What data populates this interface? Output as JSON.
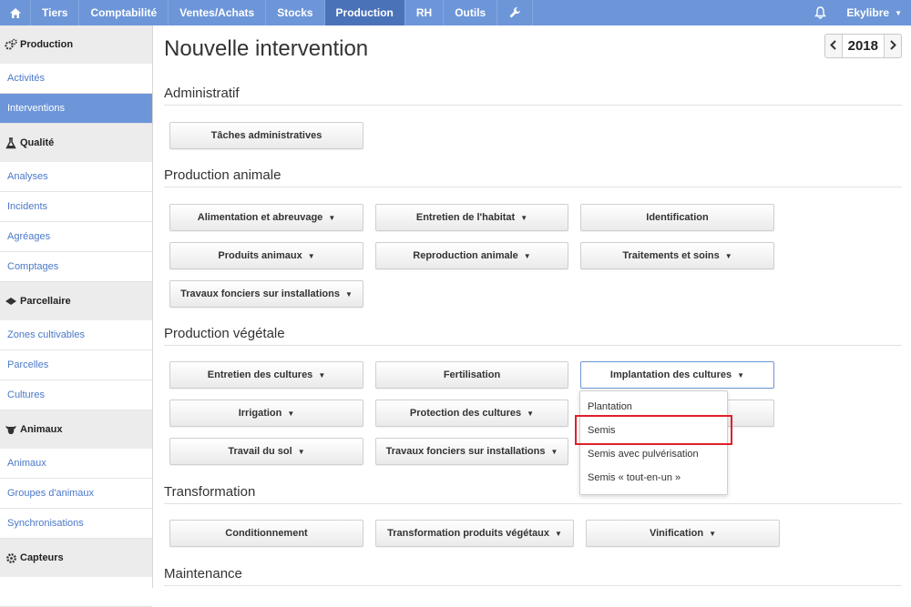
{
  "topbar": {
    "home_icon": "home-icon",
    "items": [
      "Tiers",
      "Comptabilité",
      "Ventes/Achats",
      "Stocks",
      "Production",
      "RH",
      "Outils"
    ],
    "active_index": 4,
    "tools_icon": "wrench-icon",
    "bell_icon": "bell-icon",
    "user": "Ekylibre"
  },
  "sidebar": {
    "sections": [
      {
        "title": "Production",
        "icon": "gears-icon",
        "items": [
          "Activités",
          "Interventions"
        ],
        "active": 1
      },
      {
        "title": "Qualité",
        "icon": "flask-icon",
        "items": [
          "Analyses",
          "Incidents",
          "Agréages",
          "Comptages"
        ]
      },
      {
        "title": "Parcellaire",
        "icon": "map-icon",
        "items": [
          "Zones cultivables",
          "Parcelles",
          "Cultures"
        ]
      },
      {
        "title": "Animaux",
        "icon": "cow-icon",
        "items": [
          "Animaux",
          "Groupes d'animaux",
          "Synchronisations"
        ]
      },
      {
        "title": "Capteurs",
        "icon": "gear-icon",
        "items": []
      }
    ]
  },
  "page": {
    "title": "Nouvelle intervention",
    "year": "2018",
    "prev_icon": "chevron-left-icon",
    "next_icon": "chevron-right-icon"
  },
  "sections": {
    "admin": {
      "title": "Administratif",
      "buttons": [
        "Tâches administratives"
      ]
    },
    "animal": {
      "title": "Production animale",
      "buttons": [
        "Alimentation et abreuvage",
        "Entretien de l'habitat",
        "Identification",
        "Produits animaux",
        "Reproduction animale",
        "Traitements et soins",
        "Travaux fonciers sur installations"
      ]
    },
    "vegetal": {
      "title": "Production végétale",
      "buttons": [
        "Entretien des cultures",
        "Fertilisation",
        "Implantation des cultures",
        "Irrigation",
        "Protection des cultures",
        "Travail du sol",
        "Travaux fonciers sur installations"
      ]
    },
    "transfo": {
      "title": "Transformation",
      "buttons": [
        "Conditionnement",
        "Transformation produits végétaux",
        "Vinification"
      ]
    },
    "maintenance": {
      "title": "Maintenance"
    }
  },
  "dropdown": {
    "items": [
      "Plantation",
      "Semis",
      "Semis avec pulvérisation",
      "Semis « tout-en-un »"
    ],
    "highlighted_index": 1,
    "highlight_color": "#e0202a"
  },
  "colors": {
    "accent": "#6d96d9",
    "active_nav": "#4a72b8",
    "link": "#4a78c8"
  }
}
